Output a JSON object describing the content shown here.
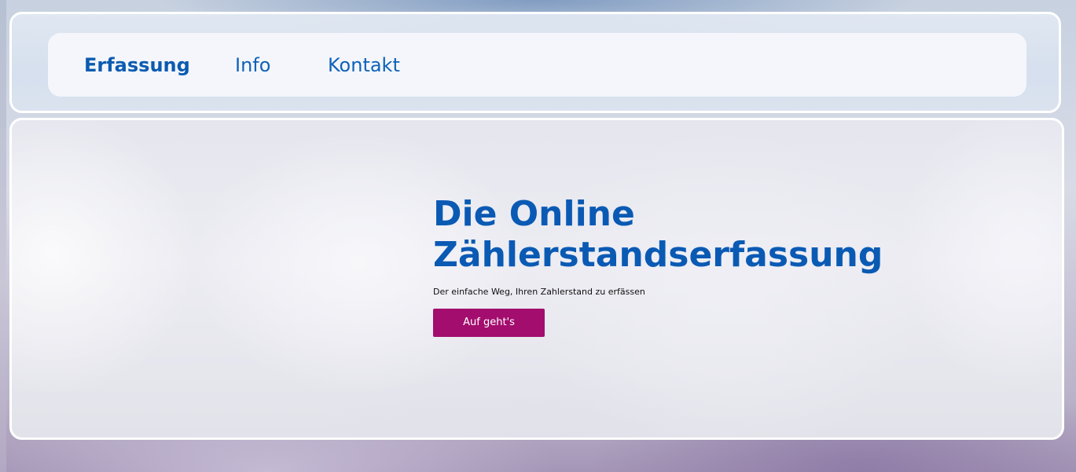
{
  "nav": {
    "items": [
      {
        "label": "Erfassung",
        "active": true
      },
      {
        "label": "Info",
        "active": false
      },
      {
        "label": "Kontakt",
        "active": false
      }
    ]
  },
  "hero": {
    "title_line1": "Die Online",
    "title_line2": "Zählerstandserfassung",
    "subtitle": "Der einfache Weg, Ihren Zahlerstand zu erfässen",
    "cta_label": "Auf geht's"
  },
  "colors": {
    "accent_blue": "#0a5ab4",
    "cta_magenta": "#a30d6e",
    "panel_border": "#ffffff"
  }
}
